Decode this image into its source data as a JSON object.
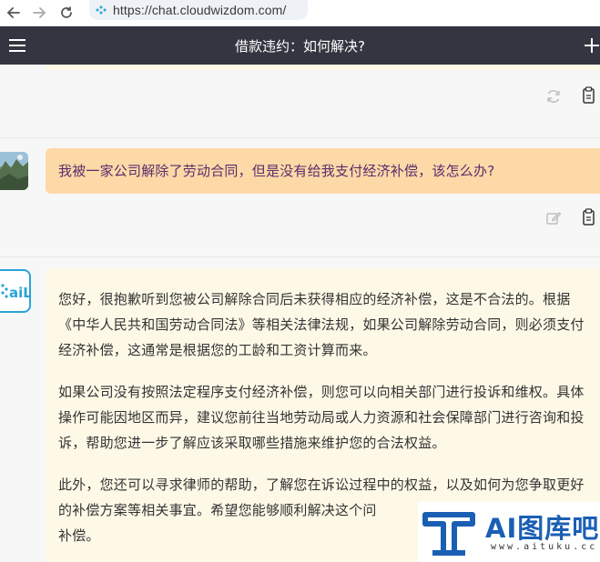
{
  "browser": {
    "url": "https://chat.cloudwizdom.com/",
    "site_icon": "cloudwizdom-favicon",
    "icons": [
      "back-arrow-icon",
      "forward-arrow-icon",
      "reload-icon"
    ]
  },
  "header": {
    "title": "借款违约：如何解决?",
    "menu_icon": "hamburger-menu-icon",
    "add_icon": "plus-icon"
  },
  "messages": [
    {
      "role": "assistant",
      "actions": [
        "regenerate-icon",
        "copy-icon"
      ]
    },
    {
      "role": "user",
      "text": "我被一家公司解除了劳动合同，但是没有给我支付经济补偿，该怎么办?",
      "actions": [
        "edit-icon",
        "copy-icon"
      ]
    },
    {
      "role": "assistant",
      "avatar_label": "aiL",
      "paragraphs": [
        "您好，很抱歉听到您被公司解除合同后未获得相应的经济补偿，这是不合法的。根据《中华人民共和国劳动合同法》等相关法律法规，如果公司解除劳动合同，则必须支付经济补偿，这通常是根据您的工龄和工资计算而来。",
        "如果公司没有按照法定程序支付经济补偿，则您可以向相关部门进行投诉和维权。具体操作可能因地区而异，建议您前往当地劳动局或人力资源和社会保障部门进行咨询和投诉，帮助您进一步了解应该采取哪些措施来维护您的合法权益。",
        "此外，您还可以寻求律师的帮助，了解您在诉讼过程中的权益，以及如何为您争取更好的补偿方案等相关事宜。希望您能够顺利解决这个问",
        "补偿。"
      ]
    }
  ],
  "watermark": {
    "text": "AI图库吧",
    "domain": "www.aituku.cc"
  },
  "colors": {
    "appbar": "#343541",
    "user_bubble": "#fdd9a8",
    "user_text": "#5a2d6a",
    "ai_bubble": "#fef9e7",
    "ai_avatar_border": "#2aa3d8",
    "watermark_blue": "#1a5fb4"
  }
}
